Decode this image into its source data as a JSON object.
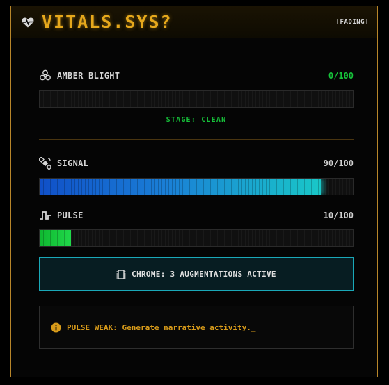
{
  "header": {
    "title": "VITALS.SYS?",
    "status": "[FADING]",
    "icon": "heart-pulse-icon"
  },
  "amber_blight": {
    "label": "AMBER BLIGHT",
    "value_text": "0/100",
    "value": 0,
    "max": 100,
    "icon": "biohazard-icon",
    "stage": "STAGE: CLEAN"
  },
  "signal": {
    "label": "SIGNAL",
    "value_text": "90/100",
    "value": 90,
    "max": 100,
    "icon": "satellite-icon"
  },
  "pulse": {
    "label": "PULSE",
    "value_text": "10/100",
    "value": 10,
    "max": 100,
    "icon": "pulse-wave-icon"
  },
  "chrome": {
    "text": "CHROME: 3 AUGMENTATIONS ACTIVE",
    "icon": "chip-icon"
  },
  "warning": {
    "text": "PULSE WEAK: Generate narrative activity.",
    "cursor": "_",
    "icon": "info-icon"
  },
  "colors": {
    "accent_amber": "#e6a81c",
    "green": "#16c33a",
    "cyan": "#19c8c8",
    "blue": "#1050c8"
  }
}
